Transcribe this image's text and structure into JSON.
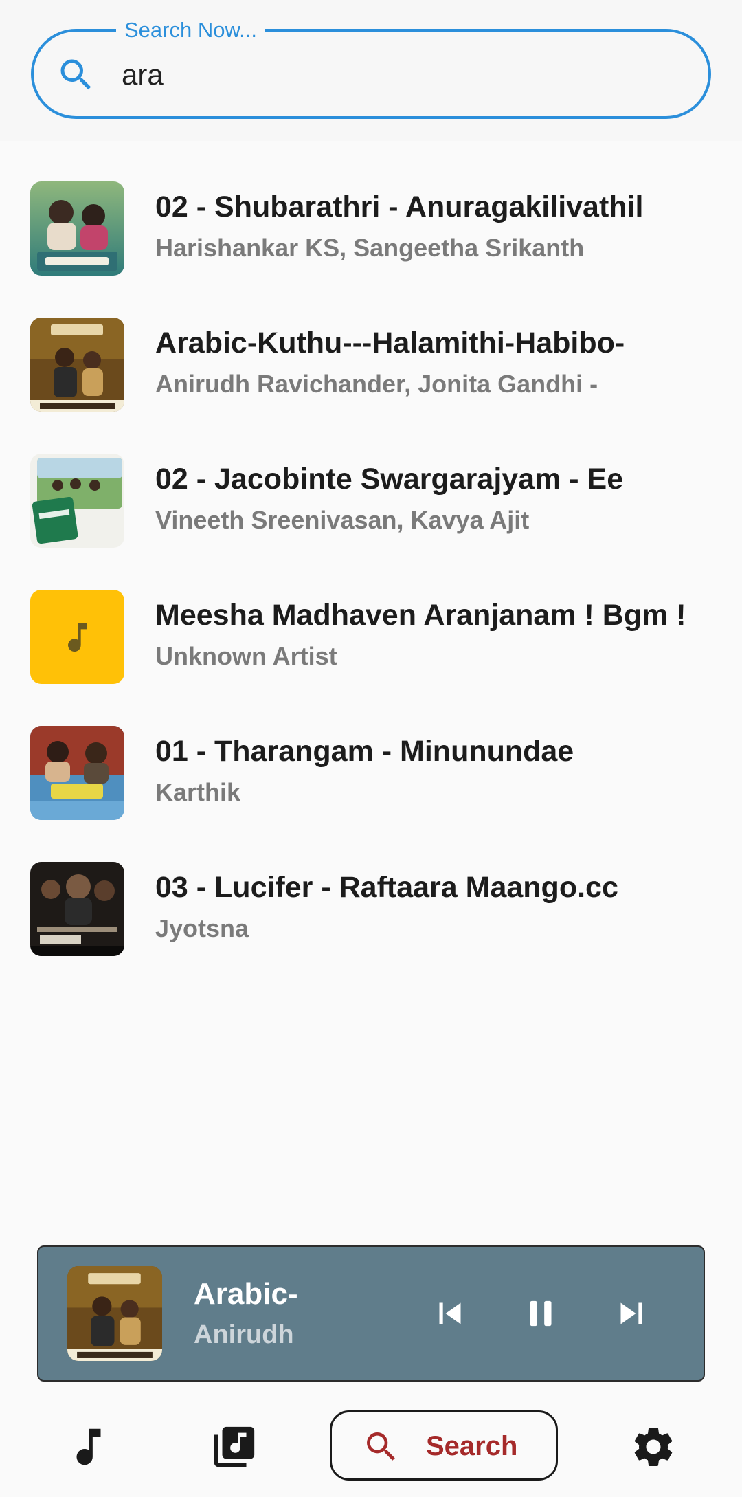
{
  "search": {
    "label": "Search Now...",
    "value": "ara"
  },
  "songs": [
    {
      "title": "02 - Shubarathri - Anuragakilivathil",
      "artist": "Harishankar KS, Sangeetha Srikanth",
      "art": "shubarathri"
    },
    {
      "title": "Arabic-Kuthu---Halamithi-Habibo-",
      "artist": "Anirudh Ravichander, Jonita Gandhi -",
      "art": "beast"
    },
    {
      "title": "02 - Jacobinte Swargarajyam - Ee",
      "artist": "Vineeth Sreenivasan, Kavya Ajit",
      "art": "jacobinte"
    },
    {
      "title": "Meesha Madhaven Aranjanam ! Bgm !",
      "artist": "Unknown Artist",
      "art": "music-note"
    },
    {
      "title": "01 - Tharangam - Minunundae",
      "artist": "Karthik",
      "art": "tharangam"
    },
    {
      "title": "03 - Lucifer - Raftaara Maango.cc",
      "artist": "Jyotsna",
      "art": "lucifer"
    }
  ],
  "player": {
    "title": "Arabic-",
    "artist": "Anirudh",
    "art": "beast",
    "state": "playing"
  },
  "nav": {
    "items": [
      "music-note-icon",
      "album-icon",
      "search",
      "settings-icon"
    ],
    "active_label": "Search"
  },
  "colors": {
    "accent": "#2b8fdb",
    "player_bg": "#607d8b",
    "nav_active": "#a52a2a",
    "placeholder_art": "#ffc107"
  }
}
